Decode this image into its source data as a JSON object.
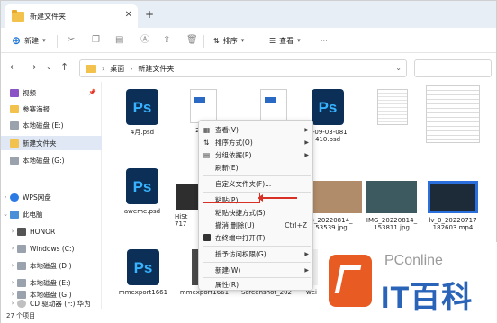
{
  "tab": {
    "title": "新建文件夹",
    "close": "✕",
    "add": "+"
  },
  "toolbar": {
    "new_label": "新建",
    "sort_label": "排序",
    "view_label": "查看",
    "more": "···"
  },
  "nav": {
    "back": "←",
    "forward": "→",
    "up": "↑",
    "refresh": "↻",
    "breadcrumbs": [
      "桌面",
      "新建文件夹"
    ]
  },
  "sidebar": {
    "items": [
      {
        "label": "视频",
        "icon": "video-icon",
        "pinned": true
      },
      {
        "label": "参赛海报",
        "icon": "folder-icon"
      },
      {
        "label": "本地磁盘 (E:)",
        "icon": "drive-icon"
      },
      {
        "label": "新建文件夹",
        "icon": "folder-icon",
        "selected": true
      },
      {
        "label": "本地磁盘 (G:)",
        "icon": "drive-icon"
      },
      {
        "label": "WPS网盘",
        "icon": "cloud-icon"
      },
      {
        "label": "此电脑",
        "icon": "pc-icon"
      },
      {
        "label": "HONOR",
        "icon": "phone-icon"
      },
      {
        "label": "Windows (C:)",
        "icon": "drive-icon"
      },
      {
        "label": "本地磁盘 (D:)",
        "icon": "drive-icon"
      },
      {
        "label": "本地磁盘 (E:)",
        "icon": "drive-icon"
      },
      {
        "label": "本地磁盘 (G:)",
        "icon": "drive-icon"
      },
      {
        "label": "CD 驱动器 (F:) 华为",
        "icon": "cd-icon"
      }
    ]
  },
  "files": [
    {
      "name": "4月.psd",
      "type": "ps"
    },
    {
      "name": "2022",
      "type": "doc"
    },
    {
      "name": "",
      "type": "doc"
    },
    {
      "name": "2-09-03-081 410.psd",
      "type": "ps"
    },
    {
      "name": "",
      "type": "doc-lines"
    },
    {
      "name": "",
      "type": "sheet"
    },
    {
      "name": "aweme.psd",
      "type": "ps"
    },
    {
      "name": "HiSt 717",
      "type": "photo-dark"
    },
    {
      "name": "",
      "type": "photo-light"
    },
    {
      "name": "3_20220814_ 53539.jpg",
      "type": "photo-hand"
    },
    {
      "name": "IMG_20220814_ 153811.jpg",
      "type": "photo-dark"
    },
    {
      "name": "lv_0_20220717 182603.mp4",
      "type": "video"
    },
    {
      "name": "mmexport1661",
      "type": "ps"
    },
    {
      "name": "mmexport1661",
      "type": "photo-dark"
    },
    {
      "name": "Screenshot_202",
      "type": "photo-light"
    },
    {
      "name": "wei",
      "type": "photo-light"
    }
  ],
  "context_menu": {
    "items": [
      {
        "label": "查看(V)",
        "submenu": true
      },
      {
        "label": "排序方式(O)",
        "submenu": true
      },
      {
        "label": "分组依据(P)",
        "submenu": true
      },
      {
        "label": "刷新(E)"
      },
      {
        "label": "自定义文件夹(F)..."
      },
      {
        "label": "粘贴(P)",
        "highlighted": true
      },
      {
        "label": "粘贴快捷方式(S)"
      },
      {
        "label": "撤消 删除(U)",
        "shortcut": "Ctrl+Z"
      },
      {
        "label": "在终端中打开(T)"
      },
      {
        "label": "授予访问权限(G)",
        "submenu": true
      },
      {
        "label": "新建(W)",
        "submenu": true
      },
      {
        "label": "属性(R)"
      }
    ]
  },
  "status": {
    "count": "27 个项目"
  },
  "watermark": {
    "pconline": "PConline",
    "brand": "IT百科"
  },
  "colors": {
    "accent": "#1a73d9",
    "highlight": "#d93025",
    "ps_bg": "#0b2f56",
    "ps_text": "#37b3ff"
  }
}
